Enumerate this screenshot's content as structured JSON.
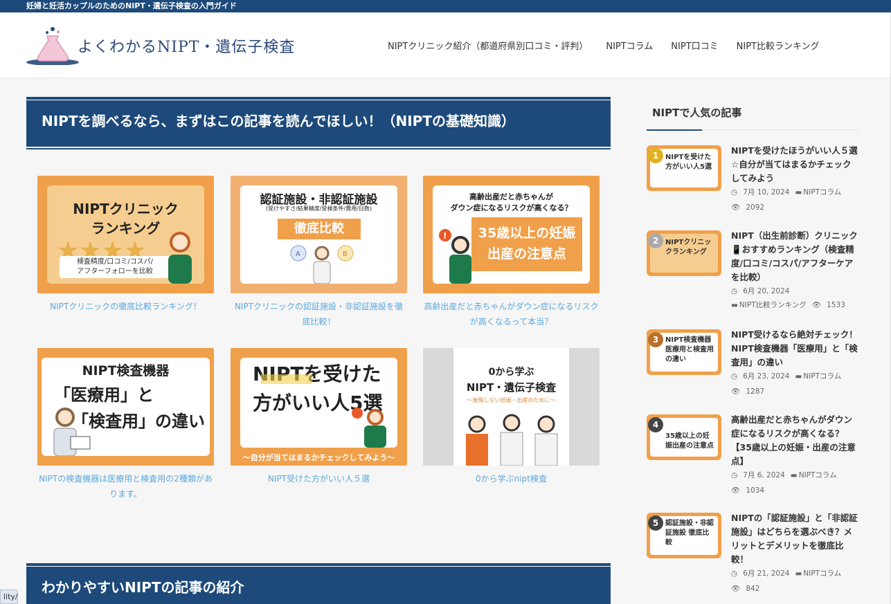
{
  "topbar": {
    "tagline": "妊婦と妊活カップルのためのNIPT・遺伝子検査の入門ガイド"
  },
  "header": {
    "logo_text": "よくわかるNIPT・遺伝子検査",
    "nav": [
      "NIPTクリニック紹介（都道府県別口コミ・評判）",
      "NIPTコラム",
      "NIPT口コミ",
      "NIPT比較ランキング"
    ]
  },
  "main": {
    "section1_title": "NIPTを調べるなら、まずはこの記事を読んでほしい！（NIPTの基礎知識）",
    "section2_title": "わかりやすいNIPTの記事の紹介",
    "cards": [
      {
        "thumb_lines": [
          "NIPTクリニック",
          "ランキング",
          "検査精度/口コミ/コスパ/",
          "アフターフォローを比較"
        ],
        "caption": "NIPTクリニックの徹底比較ランキング！"
      },
      {
        "thumb_lines": [
          "認証施設・非認証施設",
          "(受けやすさ/結果精度/受検条件/費用/日数)",
          "徹底比較"
        ],
        "caption": "NIPTクリニックの認証施設・非認証施設を徹底比較！"
      },
      {
        "thumb_lines": [
          "高齢出産だと赤ちゃんが",
          "ダウン症になるリスクが高くなる？",
          "35歳以上の妊娠",
          "出産の注意点"
        ],
        "caption": "高齢出産だと赤ちゃんがダウン症になるリスクが高くなるって本当？"
      },
      {
        "thumb_lines": [
          "NIPT検査機器",
          "「医療用」と",
          "「検査用」の違い"
        ],
        "caption": "NIPTの検査機器は医療用と検査用の2種類があります。"
      },
      {
        "thumb_lines": [
          "NIPTを受けた",
          "方がいい人5選",
          "〜自分が当てはまるかチェックしてみよう〜"
        ],
        "caption": "NIPT受けた方がいい人５選"
      },
      {
        "thumb_lines": [
          "0から学ぶ",
          "NIPT・遺伝子検査",
          "〜後悔しない妊娠・出産のために〜"
        ],
        "caption": "0から学ぶnipt検査"
      }
    ]
  },
  "sidebar": {
    "title": "NIPTで人気の記事",
    "items": [
      {
        "rank": "1",
        "title": "NIPTを受けたほうがいい人５選☆自分が当てはまるかチェックしてみよう",
        "date": "7月 10, 2024",
        "category": "NIPTコラム",
        "views": "2092",
        "thumb": "NIPTを受けた方がいい人5選"
      },
      {
        "rank": "2",
        "title": "NIPT（出生前診断）クリニック📱おすすめランキング（検査精度/口コミ/コスパ/アフターケアを比較）",
        "date": "6月 20, 2024",
        "category": "NIPT比較ランキング",
        "views": "1533",
        "thumb": "NIPTクリニックランキング"
      },
      {
        "rank": "3",
        "title": "NIPT受けるなら絶対チェック！NIPT検査機器「医療用」と「検査用」の違い",
        "date": "6月 23, 2024",
        "category": "NIPTコラム",
        "views": "1287",
        "thumb": "NIPT検査機器 医療用と検査用の違い"
      },
      {
        "rank": "4",
        "title": "高齢出産だと赤ちゃんがダウン症になるリスクが高くなる？【35歳以上の妊娠・出産の注意点】",
        "date": "7月 6, 2024",
        "category": "NIPTコラム",
        "views": "1034",
        "thumb": "35歳以上の妊娠出産の注意点"
      },
      {
        "rank": "5",
        "title": "NIPTの「認証施設」と「非認証施設」はどちらを選ぶべき？メリットとデメリットを徹底比較！",
        "date": "6月 21, 2024",
        "category": "NIPTコラム",
        "views": "842",
        "thumb": "認証施設・非認証施設 徹底比較"
      }
    ]
  },
  "statusbar": {
    "text": "lity/"
  }
}
